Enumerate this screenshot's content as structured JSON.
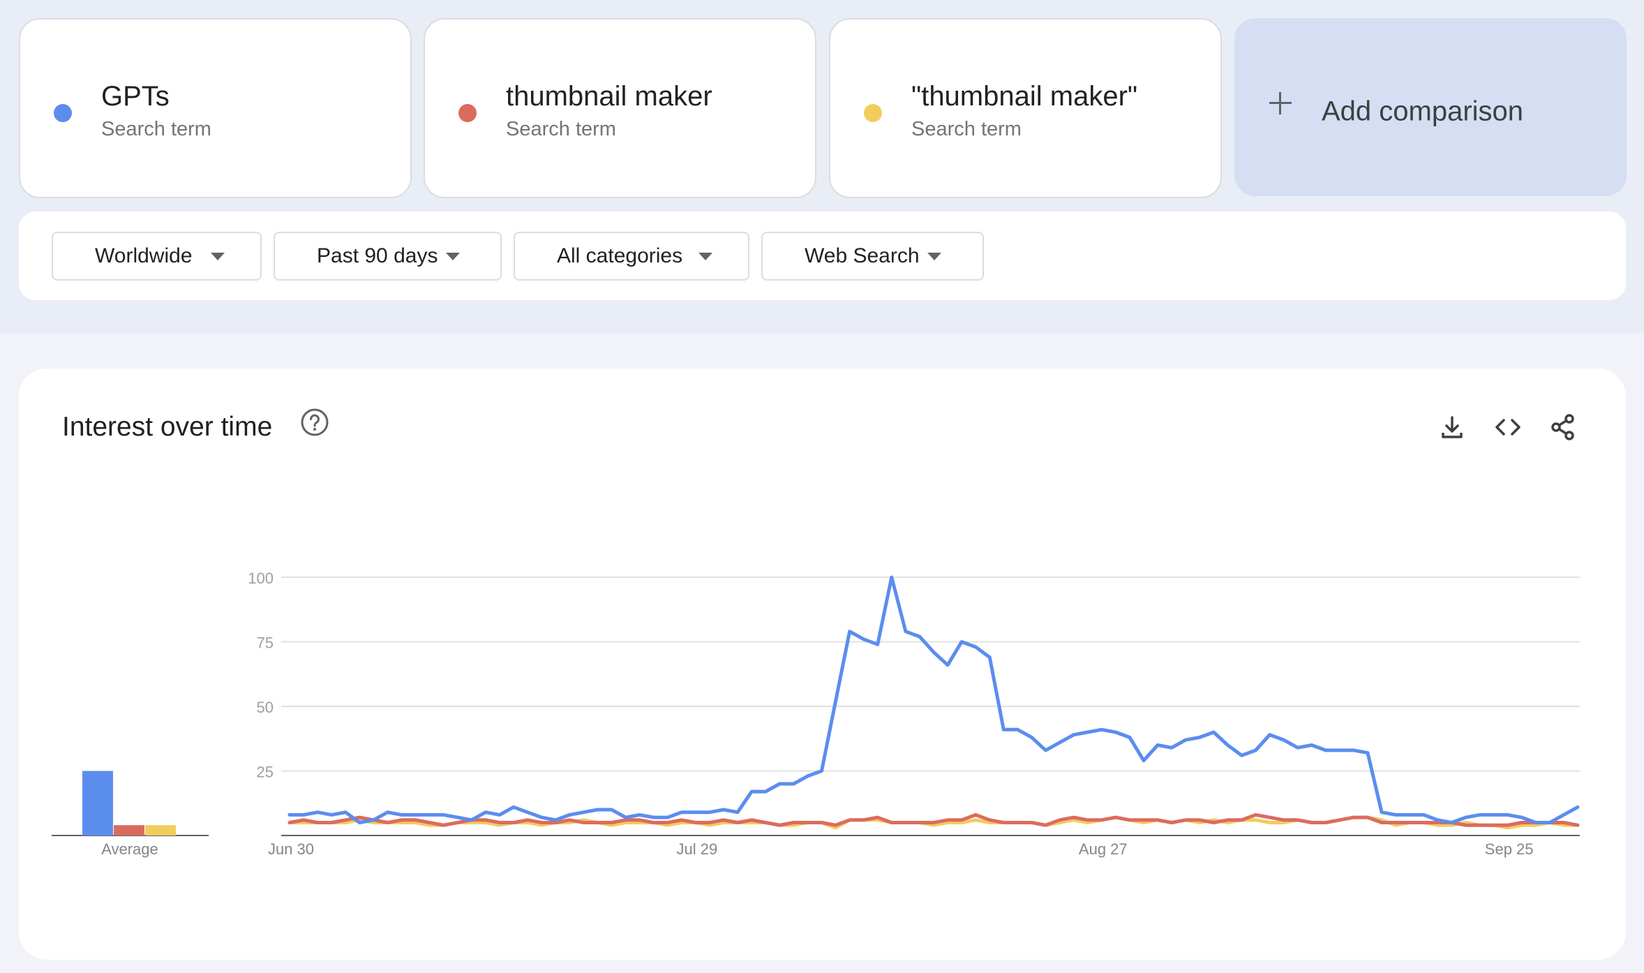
{
  "terms": [
    {
      "name": "GPTs",
      "type": "Search term",
      "color": "#5b8def"
    },
    {
      "name": "thumbnail maker",
      "type": "Search term",
      "color": "#dc6b5f"
    },
    {
      "name": "\"thumbnail maker\"",
      "type": "Search term",
      "color": "#f2cd5c"
    }
  ],
  "add_comparison": {
    "label": "Add comparison"
  },
  "filters": [
    {
      "label": "Worldwide"
    },
    {
      "label": "Past 90 days"
    },
    {
      "label": "All categories"
    },
    {
      "label": "Web Search"
    }
  ],
  "panel": {
    "title": "Interest over time",
    "help_icon": "help-circle-icon",
    "tools": [
      "download-icon",
      "embed-code-icon",
      "share-icon"
    ]
  },
  "chart_data": {
    "type": "line",
    "x_tick_labels": [
      "Jun 30",
      "Jul 29",
      "Aug 27",
      "Sep 25"
    ],
    "y_ticks": [
      25,
      50,
      75,
      100
    ],
    "ylim": [
      0,
      100
    ],
    "grid": true,
    "average_label": "Average",
    "series": [
      {
        "name": "GPTs",
        "color": "#5b8def",
        "average": 25,
        "values": [
          8,
          8,
          9,
          8,
          9,
          5,
          6,
          9,
          8,
          8,
          8,
          8,
          7,
          6,
          9,
          8,
          11,
          9,
          7,
          6,
          8,
          9,
          10,
          10,
          7,
          8,
          7,
          7,
          9,
          9,
          9,
          10,
          9,
          17,
          17,
          20,
          20,
          23,
          25,
          52,
          79,
          76,
          74,
          100,
          79,
          77,
          71,
          66,
          75,
          73,
          69,
          41,
          41,
          38,
          33,
          36,
          39,
          40,
          41,
          40,
          38,
          29,
          35,
          34,
          37,
          38,
          40,
          35,
          31,
          33,
          39,
          37,
          34,
          35,
          33,
          33,
          33,
          32,
          9,
          8,
          8,
          8,
          6,
          5,
          7,
          8,
          8,
          8,
          7,
          5,
          5,
          8,
          11
        ]
      },
      {
        "name": "thumbnail maker",
        "color": "#dc6b5f",
        "average": 4,
        "values": [
          5,
          6,
          5,
          5,
          6,
          7,
          6,
          5,
          6,
          6,
          5,
          4,
          5,
          6,
          6,
          5,
          5,
          6,
          5,
          5,
          6,
          5,
          5,
          5,
          6,
          6,
          5,
          5,
          6,
          5,
          5,
          6,
          5,
          6,
          5,
          4,
          5,
          5,
          5,
          4,
          6,
          6,
          7,
          5,
          5,
          5,
          5,
          6,
          6,
          8,
          6,
          5,
          5,
          5,
          4,
          6,
          7,
          6,
          6,
          7,
          6,
          6,
          6,
          5,
          6,
          6,
          5,
          6,
          6,
          8,
          7,
          6,
          6,
          5,
          5,
          6,
          7,
          7,
          5,
          5,
          5,
          5,
          5,
          5,
          4,
          4,
          4,
          4,
          5,
          5,
          5,
          5,
          4
        ]
      },
      {
        "name": "\"thumbnail maker\"",
        "color": "#f2cd5c",
        "average": 4,
        "values": [
          5,
          5,
          5,
          5,
          5,
          6,
          5,
          5,
          5,
          5,
          4,
          4,
          5,
          5,
          5,
          4,
          5,
          5,
          4,
          5,
          5,
          6,
          5,
          4,
          5,
          5,
          5,
          4,
          5,
          5,
          4,
          5,
          5,
          5,
          5,
          4,
          4,
          5,
          5,
          3,
          6,
          6,
          6,
          5,
          5,
          5,
          4,
          5,
          5,
          6,
          5,
          5,
          5,
          5,
          4,
          5,
          6,
          5,
          6,
          7,
          6,
          5,
          6,
          5,
          6,
          5,
          6,
          5,
          6,
          6,
          5,
          5,
          6,
          5,
          5,
          6,
          7,
          7,
          6,
          4,
          5,
          5,
          4,
          4,
          5,
          4,
          4,
          3,
          4,
          4,
          5,
          4,
          4
        ]
      }
    ]
  }
}
